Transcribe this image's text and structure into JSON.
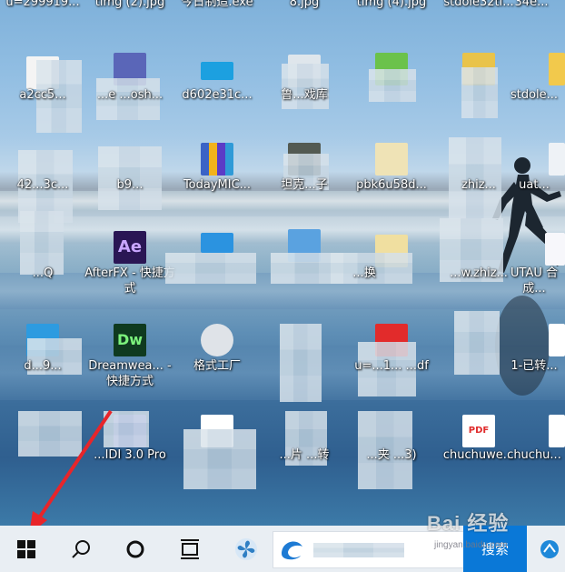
{
  "desktop": {
    "top_partial_row": [
      "u=299919...",
      "timg (2).jpg",
      "今日制造.exe",
      "8.jpg",
      "timg (4).jpg",
      "stdole32tl...",
      "34e..."
    ],
    "row1": [
      "a2cc5...",
      "...e ...osh...",
      "d602e31c...",
      "鲁...戏库",
      "",
      "",
      "stdole..."
    ],
    "row2": [
      "42...3c...",
      "b9...",
      "TodayMIC...",
      "坦克...子",
      "pbk6u58d...",
      "zhiz...",
      "uat..."
    ],
    "row3": [
      "...Q",
      "AfterFX - 快捷方式",
      "...",
      "...",
      "...换",
      "...w.zhiz...",
      "UTAU 合成..."
    ],
    "row4": [
      "d...9...",
      "Dreamwea... - 快捷方式",
      "格式工厂",
      "",
      "u=...1... ...df",
      "",
      "1-已转..."
    ],
    "row5": [
      "...",
      "...IDI 3.0 Pro",
      "",
      "...片 ...转",
      "...夹 ...3)",
      "chuchuwe...",
      "chuchu..."
    ]
  },
  "taskbar": {
    "start_icon": "windows-logo",
    "search_button_label": "搜索",
    "icons": [
      "windows-logo",
      "search-icon",
      "cortana-circle-icon",
      "task-view-icon",
      "fan-app-icon",
      "edge-browser-icon"
    ]
  },
  "watermark": {
    "text": "Bai 经验",
    "sub": "jingyan.baidu.com"
  },
  "colors": {
    "taskbar_bg": "#e9eef3",
    "search_accent": "#0a78d7",
    "annotation_arrow": "#e8252a"
  }
}
